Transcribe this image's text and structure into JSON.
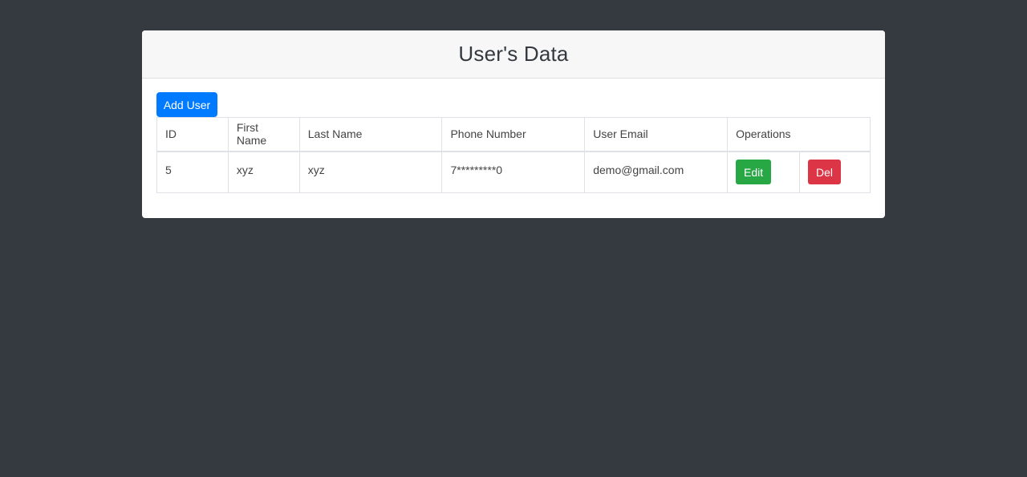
{
  "card": {
    "title": "User's Data",
    "add_button_label": "Add User"
  },
  "table": {
    "headers": [
      "ID",
      "First Name",
      "Last Name",
      "Phone Number",
      "User Email",
      "Operations"
    ],
    "rows": [
      {
        "id": "5",
        "first_name": "xyz",
        "last_name": "xyz",
        "phone": "7*********0",
        "email": "demo@gmail.com",
        "edit_label": "Edit",
        "del_label": "Del"
      }
    ]
  },
  "colors": {
    "background": "#343a40",
    "primary": "#007bff",
    "success": "#28a745",
    "danger": "#dc3545"
  }
}
